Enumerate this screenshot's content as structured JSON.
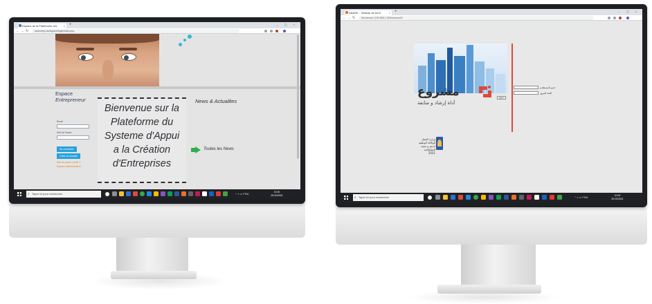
{
  "left_monitor": {
    "browser": {
      "tab_title": "Espace de la Plateforme d'A",
      "new_tab_symbol": "+",
      "close_symbol": "×",
      "url": "www.eeps.dz/espace/login/index.php",
      "window_controls": "– ▢ ×"
    },
    "page": {
      "espace_title_1": "Espace",
      "espace_title_2": "Entrepreneur",
      "field1_label": "Email",
      "field2_label": "Mot de Passe",
      "login_button": "Se connecter",
      "register_button": "Créer un compte",
      "link1": "Mot de passe oublié ?",
      "link2": "Espace administrateur",
      "welcome_lines": [
        "Bienvenue sur la",
        "Plateforme du",
        "Systeme d'Appui",
        "a la Création",
        "d'Entreprises"
      ],
      "news_title": "News & Actualites",
      "all_news": "Toutes les News"
    },
    "taskbar": {
      "search_placeholder": "Taper ici pour rechercher",
      "time": "10:00",
      "date": "20/10/2021",
      "tray": "^ ◖ ▭ FRA"
    }
  },
  "right_monitor": {
    "browser": {
      "tab_title": "ANADE - Tableau de bord",
      "new_tab_symbol": "+",
      "close_symbol": "×",
      "url": "Not secure | 192.168.1.100/machrou3/",
      "window_controls": "– ▢ ×"
    },
    "page": {
      "logo_text": "مشروع",
      "logo_subtitle": "أداة إرشاد و متابعة",
      "username_label": "اسم المستخدم",
      "password_label": "كلمة المرور",
      "login_button": "دخول",
      "footer_lines": [
        "وزارة العمل",
        "الوكالة الوطنية",
        "لدعم و تنمية",
        "المقاولاتية",
        "2021"
      ]
    },
    "taskbar": {
      "search_placeholder": "Taper ici pour rechercher",
      "time": "10:00",
      "date": "20/10/2021",
      "tray": "^ ◖ ▭ FRA"
    }
  },
  "colors": {
    "bezel": "#1d1f22",
    "taskbar": "#202124",
    "accent_blue": "#27a2db",
    "accent_orange": "#e0862a",
    "news_arrow_green": "#2fae4a",
    "brand_red": "#d94a3d",
    "page_gray": "#e4e4e4"
  },
  "icons": [
    "back-arrow-icon",
    "forward-arrow-icon",
    "reload-icon",
    "windows-start-icon",
    "search-icon",
    "green-arrow-icon",
    "arabic-emblem-icon"
  ]
}
